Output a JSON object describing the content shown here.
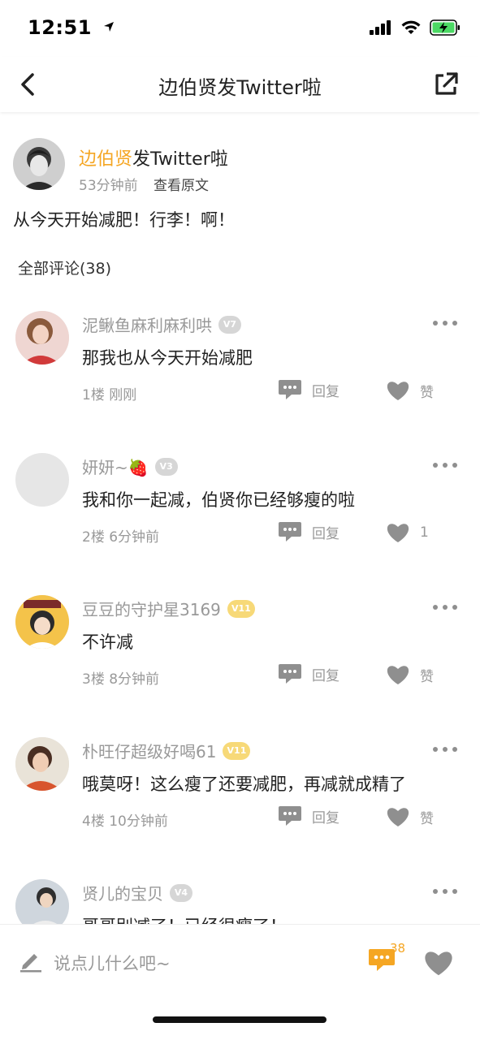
{
  "status_bar": {
    "time": "12:51",
    "location_icon": "location-arrow-icon",
    "signal_icon": "cellular-signal-icon",
    "wifi_icon": "wifi-icon",
    "battery_icon": "battery-charging-icon",
    "battery_color": "#4cd964"
  },
  "nav": {
    "back_icon": "back-chevron-icon",
    "title": "边伯贤发Twitter啦",
    "share_icon": "share-external-icon"
  },
  "post": {
    "author_highlight": "边伯贤",
    "author_rest": "发Twitter啦",
    "time": "53分钟前",
    "view_original": "查看原文",
    "text": "从今天开始减肥！行李！啊！"
  },
  "comments_header": "全部评论(38)",
  "comments": [
    {
      "name": "泥鳅鱼麻利麻利哄",
      "badge": "V7",
      "badge_color": "gray",
      "text": "那我也从今天开始减肥",
      "floor": "1楼",
      "time": "刚刚",
      "reply_label": "回复",
      "like_label": "赞"
    },
    {
      "name": "妍妍~🍓",
      "badge": "V3",
      "badge_color": "gray",
      "text": "我和你一起减，伯贤你已经够瘦的啦",
      "floor": "2楼",
      "time": "6分钟前",
      "reply_label": "回复",
      "like_label": "1"
    },
    {
      "name": "豆豆的守护星3169",
      "badge": "V11",
      "badge_color": "gold",
      "text": "不许减",
      "floor": "3楼",
      "time": "8分钟前",
      "reply_label": "回复",
      "like_label": "赞"
    },
    {
      "name": "朴旺仔超级好喝61",
      "badge": "V11",
      "badge_color": "gold",
      "text": "哦莫呀！这么瘦了还要减肥，再减就成精了",
      "floor": "4楼",
      "time": "10分钟前",
      "reply_label": "回复",
      "like_label": "赞"
    },
    {
      "name": "贤儿的宝贝",
      "badge": "V4",
      "badge_color": "gray",
      "text": "哥哥别减了！已经很瘦了！",
      "floor": "",
      "time": "",
      "reply_label": "",
      "like_label": ""
    }
  ],
  "input_bar": {
    "placeholder": "说点儿什么吧~",
    "comment_count": "38",
    "accent": "#f5a623"
  }
}
